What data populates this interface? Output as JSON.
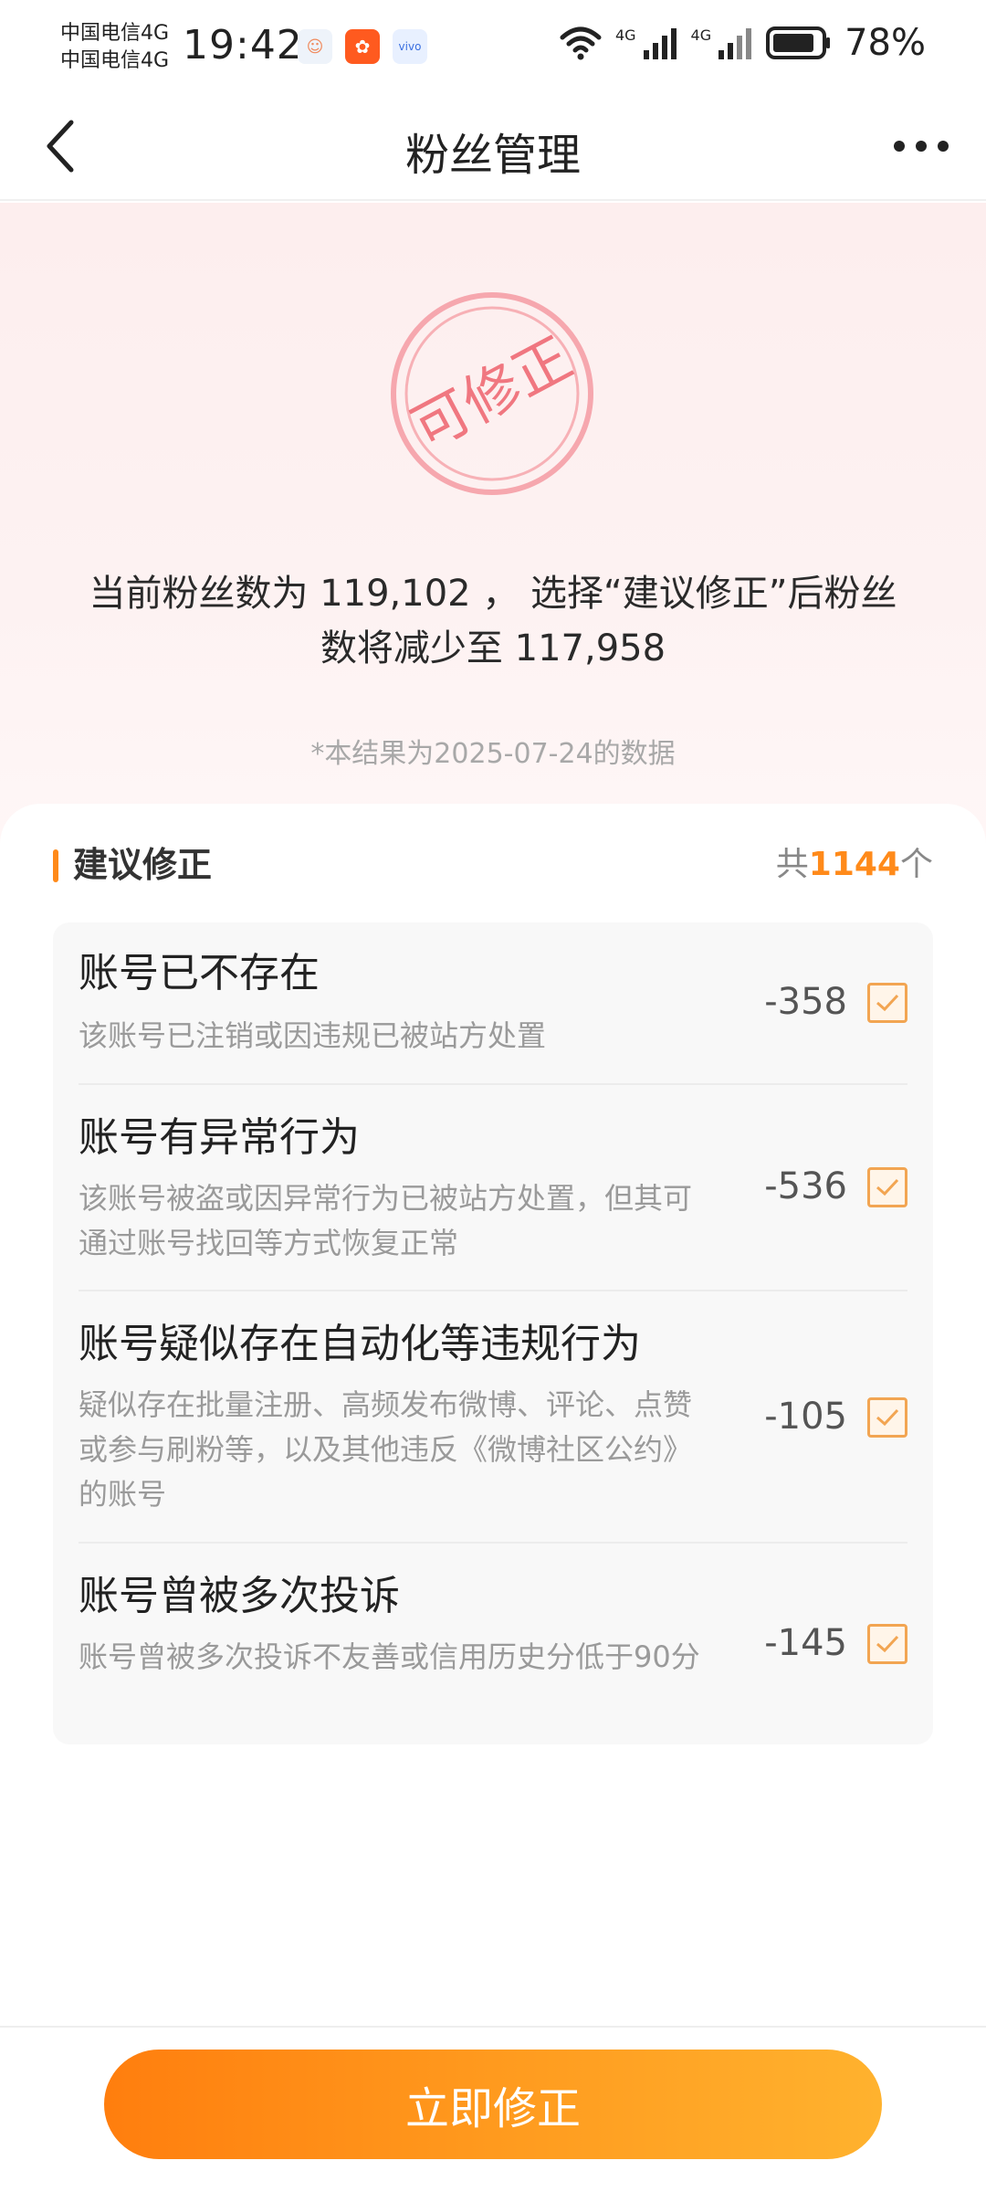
{
  "status_bar": {
    "carrier_1": "中国电信4G",
    "carrier_2": "中国电信4G",
    "time": "19:42",
    "sig_label_1": "4G",
    "sig_label_2": "4G",
    "battery": "78%"
  },
  "nav": {
    "title": "粉丝管理"
  },
  "hero": {
    "stamp_text": "可修正",
    "summary_line": "当前粉丝数为 119,102 ， 选择“建议修正”后粉丝数将减少至 117,958",
    "note": "*本结果为2025-07-24的数据"
  },
  "section": {
    "title": "建议修正",
    "count_prefix": "共",
    "count_value": "1144",
    "count_suffix": "个"
  },
  "items": [
    {
      "title": "账号已不存在",
      "desc": "该账号已注销或因违规已被站方处置",
      "delta": "-358",
      "checked": true
    },
    {
      "title": "账号有异常行为",
      "desc": "该账号被盗或因异常行为已被站方处置，但其可通过账号找回等方式恢复正常",
      "delta": "-536",
      "checked": true
    },
    {
      "title": "账号疑似存在自动化等违规行为",
      "desc": "疑似存在批量注册、高频发布微博、评论、点赞或参与刷粉等，以及其他违反《微博社区公约》的账号",
      "delta": "-105",
      "checked": true
    },
    {
      "title": "账号曾被多次投诉",
      "desc": "账号曾被多次投诉不友善或信用历史分低于90分",
      "delta": "-145",
      "checked": true
    }
  ],
  "bottom": {
    "button_label": "立即修正"
  },
  "colors": {
    "accent": "#ff8a1a",
    "stamp": "#f0616d",
    "checkbox": "#f2a552"
  }
}
